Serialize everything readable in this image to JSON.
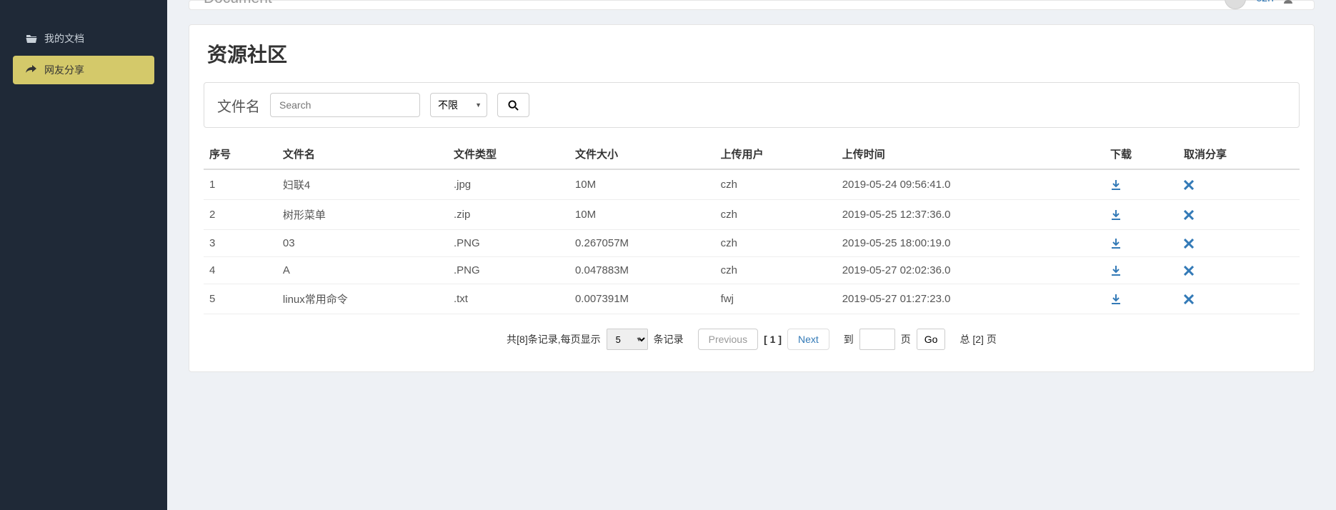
{
  "header": {
    "brand": "Document",
    "username": "czh"
  },
  "sidebar": {
    "items": [
      {
        "label": "我的文档"
      },
      {
        "label": "网友分享"
      }
    ]
  },
  "page": {
    "title": "资源社区"
  },
  "filter": {
    "label": "文件名",
    "search_placeholder": "Search",
    "type_selected": "不限"
  },
  "table": {
    "headers": {
      "seq": "序号",
      "name": "文件名",
      "type": "文件类型",
      "size": "文件大小",
      "user": "上传用户",
      "time": "上传时间",
      "download": "下载",
      "cancel": "取消分享"
    },
    "rows": [
      {
        "seq": "1",
        "name": "妇联4",
        "type": ".jpg",
        "size": "10M",
        "user": "czh",
        "time": "2019-05-24 09:56:41.0"
      },
      {
        "seq": "2",
        "name": "树形菜单",
        "type": ".zip",
        "size": "10M",
        "user": "czh",
        "time": "2019-05-25 12:37:36.0"
      },
      {
        "seq": "3",
        "name": "03",
        "type": ".PNG",
        "size": "0.267057M",
        "user": "czh",
        "time": "2019-05-25 18:00:19.0"
      },
      {
        "seq": "4",
        "name": "A",
        "type": ".PNG",
        "size": "0.047883M",
        "user": "czh",
        "time": "2019-05-27 02:02:36.0"
      },
      {
        "seq": "5",
        "name": "linux常用命令",
        "type": ".txt",
        "size": "0.007391M",
        "user": "fwj",
        "time": "2019-05-27 01:27:23.0"
      }
    ]
  },
  "pagination": {
    "total_prefix": "共[",
    "total_count": "8",
    "total_suffix": "]条记录,每页显示",
    "per_page": "5",
    "records_label": "条记录",
    "previous": "Previous",
    "current": "[ 1 ]",
    "next": "Next",
    "goto_prefix": "到",
    "goto_suffix": "页",
    "go": "Go",
    "total_pages_prefix": "总 [",
    "total_pages": "2",
    "total_pages_suffix": "] 页"
  }
}
